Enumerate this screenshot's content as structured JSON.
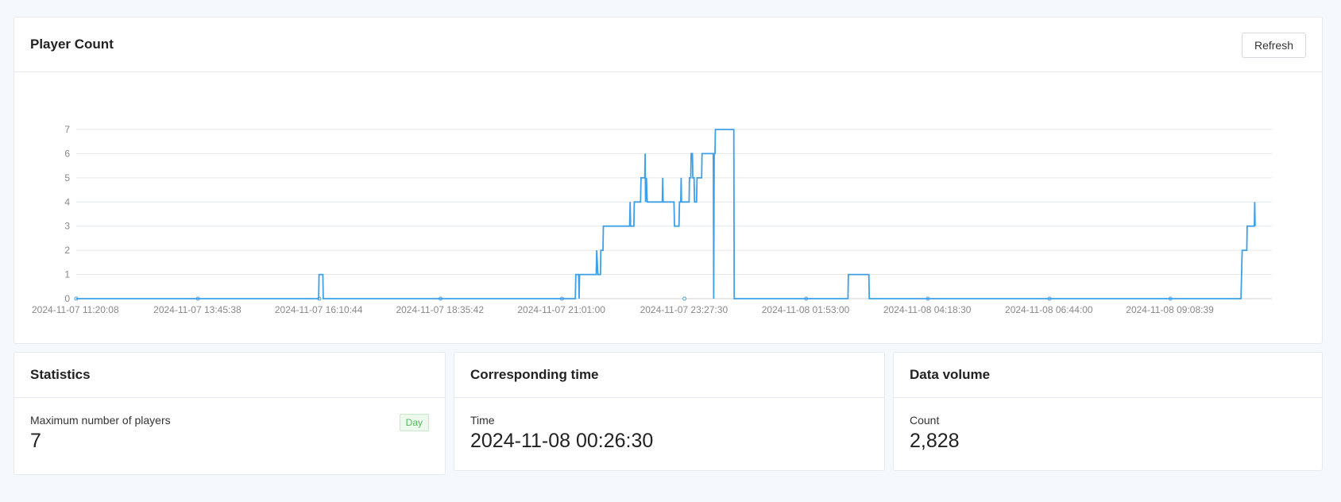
{
  "chart_panel": {
    "title": "Player Count",
    "refresh_label": "Refresh"
  },
  "chart_data": {
    "type": "line",
    "title": "Player Count",
    "xlabel": "",
    "ylabel": "",
    "x_tick_labels": [
      "2024-11-07 11:20:08",
      "2024-11-07 13:45:38",
      "2024-11-07 16:10:44",
      "2024-11-07 18:35:42",
      "2024-11-07 21:01:00",
      "2024-11-07 23:27:30",
      "2024-11-08 01:53:00",
      "2024-11-08 04:18:30",
      "2024-11-08 06:44:00",
      "2024-11-08 09:08:39"
    ],
    "y_ticks": [
      0,
      1,
      2,
      3,
      4,
      5,
      6,
      7
    ],
    "ylim": [
      0,
      7
    ],
    "xlim": [
      "2024-11-07 11:20:08",
      "2024-11-08 11:10:00"
    ],
    "grid": true,
    "line_color": "#3fa0e8",
    "series": [
      {
        "points": [
          [
            "2024-11-07 11:20:08",
            0
          ],
          [
            "2024-11-07 16:10:00",
            0
          ],
          [
            "2024-11-07 16:10:30",
            1
          ],
          [
            "2024-11-07 16:15:00",
            1
          ],
          [
            "2024-11-07 16:15:30",
            0
          ],
          [
            "2024-11-07 21:17:00",
            0
          ],
          [
            "2024-11-07 21:17:30",
            1
          ],
          [
            "2024-11-07 21:21:00",
            1
          ],
          [
            "2024-11-07 21:21:30",
            0
          ],
          [
            "2024-11-07 21:22:00",
            1
          ],
          [
            "2024-11-07 21:42:00",
            1
          ],
          [
            "2024-11-07 21:42:30",
            2
          ],
          [
            "2024-11-07 21:44:00",
            1
          ],
          [
            "2024-11-07 21:47:00",
            1
          ],
          [
            "2024-11-07 21:47:30",
            2
          ],
          [
            "2024-11-07 21:50:00",
            2
          ],
          [
            "2024-11-07 21:50:30",
            3
          ],
          [
            "2024-11-07 22:22:00",
            3
          ],
          [
            "2024-11-07 22:22:30",
            4
          ],
          [
            "2024-11-07 22:23:00",
            3
          ],
          [
            "2024-11-07 22:27:00",
            3
          ],
          [
            "2024-11-07 22:27:30",
            4
          ],
          [
            "2024-11-07 22:35:00",
            4
          ],
          [
            "2024-11-07 22:35:30",
            5
          ],
          [
            "2024-11-07 22:40:00",
            5
          ],
          [
            "2024-11-07 22:40:30",
            6
          ],
          [
            "2024-11-07 22:41:00",
            4
          ],
          [
            "2024-11-07 22:42:00",
            5
          ],
          [
            "2024-11-07 22:43:00",
            4
          ],
          [
            "2024-11-07 23:01:00",
            4
          ],
          [
            "2024-11-07 23:01:30",
            5
          ],
          [
            "2024-11-07 23:02:00",
            4
          ],
          [
            "2024-11-07 23:15:00",
            4
          ],
          [
            "2024-11-07 23:15:30",
            3
          ],
          [
            "2024-11-07 23:21:00",
            3
          ],
          [
            "2024-11-07 23:21:30",
            4
          ],
          [
            "2024-11-07 23:23:00",
            4
          ],
          [
            "2024-11-07 23:23:30",
            5
          ],
          [
            "2024-11-07 23:24:00",
            4
          ],
          [
            "2024-11-07 23:33:00",
            4
          ],
          [
            "2024-11-07 23:33:30",
            5
          ],
          [
            "2024-11-07 23:35:00",
            5
          ],
          [
            "2024-11-07 23:35:30",
            6
          ],
          [
            "2024-11-07 23:37:00",
            6
          ],
          [
            "2024-11-07 23:37:30",
            5
          ],
          [
            "2024-11-07 23:39:00",
            5
          ],
          [
            "2024-11-07 23:39:30",
            4
          ],
          [
            "2024-11-07 23:42:00",
            4
          ],
          [
            "2024-11-07 23:42:30",
            5
          ],
          [
            "2024-11-07 23:48:00",
            5
          ],
          [
            "2024-11-07 23:48:30",
            6
          ],
          [
            "2024-11-08 00:02:00",
            6
          ],
          [
            "2024-11-08 00:02:30",
            0
          ],
          [
            "2024-11-08 00:03:00",
            6
          ],
          [
            "2024-11-08 00:04:00",
            6
          ],
          [
            "2024-11-08 00:04:30",
            7
          ],
          [
            "2024-11-08 00:26:30",
            7
          ],
          [
            "2024-11-08 00:27:00",
            0
          ],
          [
            "2024-11-08 02:43:00",
            0
          ],
          [
            "2024-11-08 02:43:30",
            1
          ],
          [
            "2024-11-08 03:08:00",
            1
          ],
          [
            "2024-11-08 03:08:30",
            0
          ],
          [
            "2024-11-08 10:33:00",
            0
          ],
          [
            "2024-11-08 10:34:30",
            2
          ],
          [
            "2024-11-08 10:40:00",
            2
          ],
          [
            "2024-11-08 10:40:30",
            3
          ],
          [
            "2024-11-08 10:49:00",
            3
          ],
          [
            "2024-11-08 10:49:30",
            4
          ],
          [
            "2024-11-08 10:50:00",
            3
          ]
        ]
      }
    ]
  },
  "stats": {
    "title": "Statistics",
    "label": "Maximum number of players",
    "value": "7",
    "badge": "Day"
  },
  "time_card": {
    "title": "Corresponding time",
    "label": "Time",
    "value": "2024-11-08 00:26:30"
  },
  "volume_card": {
    "title": "Data volume",
    "label": "Count",
    "value": "2,828"
  }
}
